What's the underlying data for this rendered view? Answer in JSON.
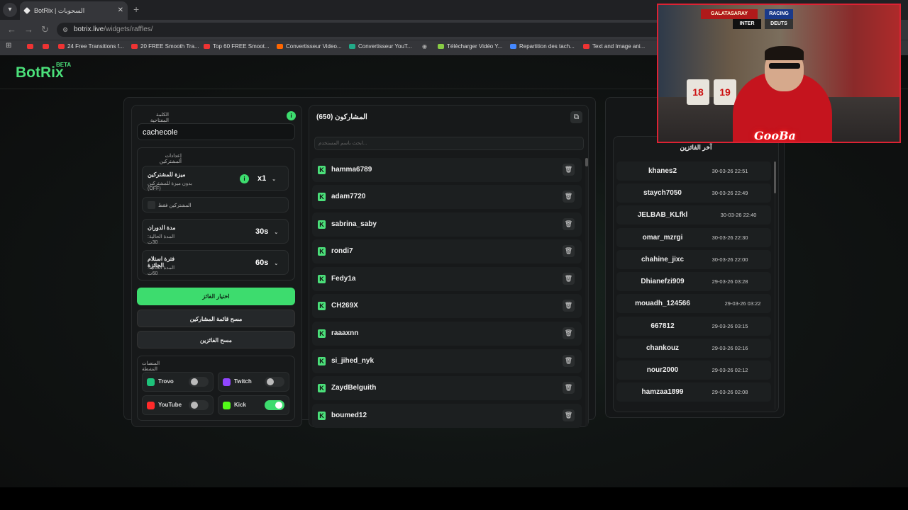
{
  "browser": {
    "tab_title": "BotRix | السحوبات",
    "url_host": "botrix.live",
    "url_path": "/widgets/raffles/",
    "bookmarks": [
      "24 Free Transitions f...",
      "20 FREE Smooth Tra...",
      "Top 60 FREE Smoot...",
      "Convertisseur Video...",
      "Convertisseur YouT...",
      "Télécharger Vidéo Y...",
      "Repartition des tach...",
      "Text and Image ani..."
    ]
  },
  "header": {
    "logo": "BotRix",
    "beta": "BETA"
  },
  "settings": {
    "keyword_label": "الكلمة المفتاحية",
    "keyword_value": "cachecole",
    "subscriber_settings_label": "إعدادات المشتركين",
    "sub_feature_title": "ميزة للمشتركين",
    "sub_feature_desc": "بدون ميزة للمشتركين (OFF)",
    "sub_multiplier": "x1",
    "subs_only_label": "المشتركين فقط",
    "spin_duration_title": "مدة الدوران",
    "spin_duration_desc": "المدة الحالية: 30ث",
    "spin_duration_value": "30s",
    "claim_title": "فترة استلام الجائزة",
    "claim_desc": "المدة الحالية: 60ث",
    "claim_value": "60s",
    "pick_winner": "اختيار الفائز",
    "clear_participants": "مسح قائمة المشاركين",
    "clear_winners": "مسح الفائزين",
    "platforms_label": "المنصات النشطة",
    "platforms": [
      {
        "name": "Trovo",
        "color": "#1ec27a",
        "on": false
      },
      {
        "name": "Twitch",
        "color": "#9146ff",
        "on": false
      },
      {
        "name": "YouTube",
        "color": "#ff2a2a",
        "on": false
      },
      {
        "name": "Kick",
        "color": "#53fc18",
        "on": true
      }
    ]
  },
  "participants": {
    "title": "المشاركون (650)",
    "search_placeholder": "ابحث باسم المستخدم...",
    "list": [
      "hamma6789",
      "adam7720",
      "sabrina_saby",
      "rondi7",
      "Fedy1a",
      "CH269X",
      "raaaxnn",
      "si_jihed_nyk",
      "ZaydBelguith",
      "boumed12"
    ]
  },
  "winners": {
    "title": "آخر الفائزين",
    "list": [
      {
        "name": "khanes2",
        "time": "30-03-26 22:51"
      },
      {
        "name": "staych7050",
        "time": "30-03-26 22:49"
      },
      {
        "name": "JELBAB_KLfkl",
        "time": "30-03-26 22:40"
      },
      {
        "name": "omar_mzrgi",
        "time": "30-03-26 22:30"
      },
      {
        "name": "chahine_jixc",
        "time": "30-03-26 22:00"
      },
      {
        "name": "Dhianefzi909",
        "time": "29-03-26 03:28"
      },
      {
        "name": "mouadh_124566",
        "time": "29-03-26 03:22"
      },
      {
        "name": "667812",
        "time": "29-03-26 03:15"
      },
      {
        "name": "chankouz",
        "time": "29-03-26 02:16"
      },
      {
        "name": "nour2000",
        "time": "29-03-26 02:12"
      },
      {
        "name": "hamzaa1899",
        "time": "29-03-26 02:08"
      }
    ]
  },
  "webcam": {
    "overlay_name": "GooBa",
    "jersey_left": "18",
    "jersey_right": "19",
    "scarf_1": "GALATASARAY",
    "scarf_2": "RACING",
    "scarf_3": "INTER",
    "scarf_4": "DEUTS"
  }
}
